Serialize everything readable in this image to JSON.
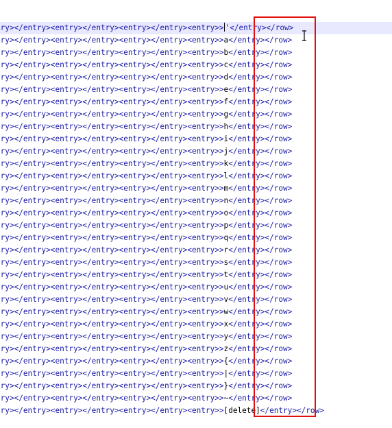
{
  "editor": {
    "prefix": "try></entry><entry></entry><entry></entry><entry>",
    "open_tail": "",
    "close_tag": "</entry>",
    "row_close": "</row>",
    "lines": [
      {
        "value": "'"
      },
      {
        "value": "a"
      },
      {
        "value": "b"
      },
      {
        "value": "c"
      },
      {
        "value": "d"
      },
      {
        "value": "e"
      },
      {
        "value": "f"
      },
      {
        "value": "g"
      },
      {
        "value": "h"
      },
      {
        "value": "i"
      },
      {
        "value": "j"
      },
      {
        "value": "k"
      },
      {
        "value": "l"
      },
      {
        "value": "m"
      },
      {
        "value": "n"
      },
      {
        "value": "o"
      },
      {
        "value": "p"
      },
      {
        "value": "q"
      },
      {
        "value": "r"
      },
      {
        "value": "s"
      },
      {
        "value": "t"
      },
      {
        "value": "u"
      },
      {
        "value": "v"
      },
      {
        "value": "w"
      },
      {
        "value": "x"
      },
      {
        "value": "y"
      },
      {
        "value": "z"
      },
      {
        "value": "{"
      },
      {
        "value": "|"
      },
      {
        "value": "}"
      },
      {
        "value": "~"
      },
      {
        "value": "[delete]"
      }
    ],
    "current_line": 0
  },
  "colors": {
    "tag": "#1a1aa6",
    "value": "#000000",
    "current_line_bg": "#e8e8ff",
    "highlight_box": "#e01010"
  }
}
